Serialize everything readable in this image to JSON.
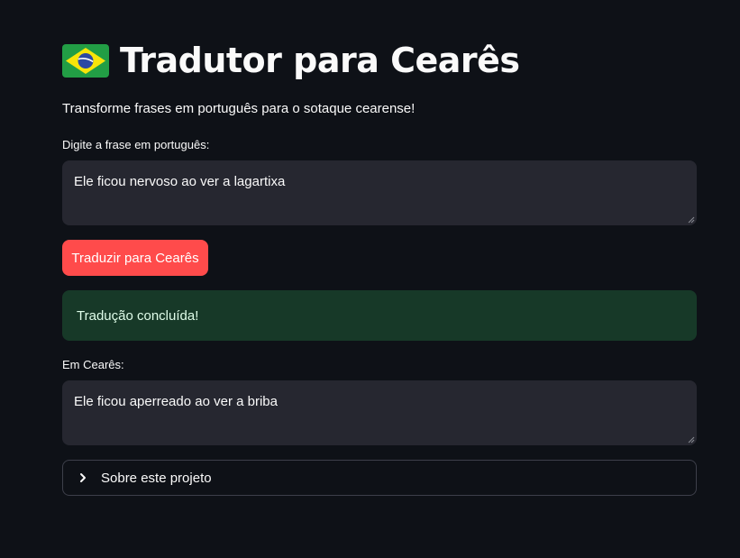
{
  "header": {
    "flag_icon": "brazil-flag-icon",
    "title": "Tradutor para Cearês",
    "subtitle": "Transforme frases em português para o sotaque cearense!"
  },
  "input": {
    "label": "Digite a frase em português:",
    "value": "Ele ficou nervoso ao ver a lagartixa"
  },
  "translate_button": {
    "label": "Traduzir para Cearês"
  },
  "success_alert": {
    "text": "Tradução concluída!"
  },
  "output": {
    "label": "Em Cearês:",
    "value": "Ele ficou aperreado ao ver a briba"
  },
  "about_expander": {
    "label": "Sobre este projeto",
    "icon": "chevron-right-icon"
  },
  "colors": {
    "background": "#0e1117",
    "field": "#262730",
    "primary_button": "#ff4b4b",
    "success_bg": "#173928",
    "success_text": "#dffde9"
  }
}
